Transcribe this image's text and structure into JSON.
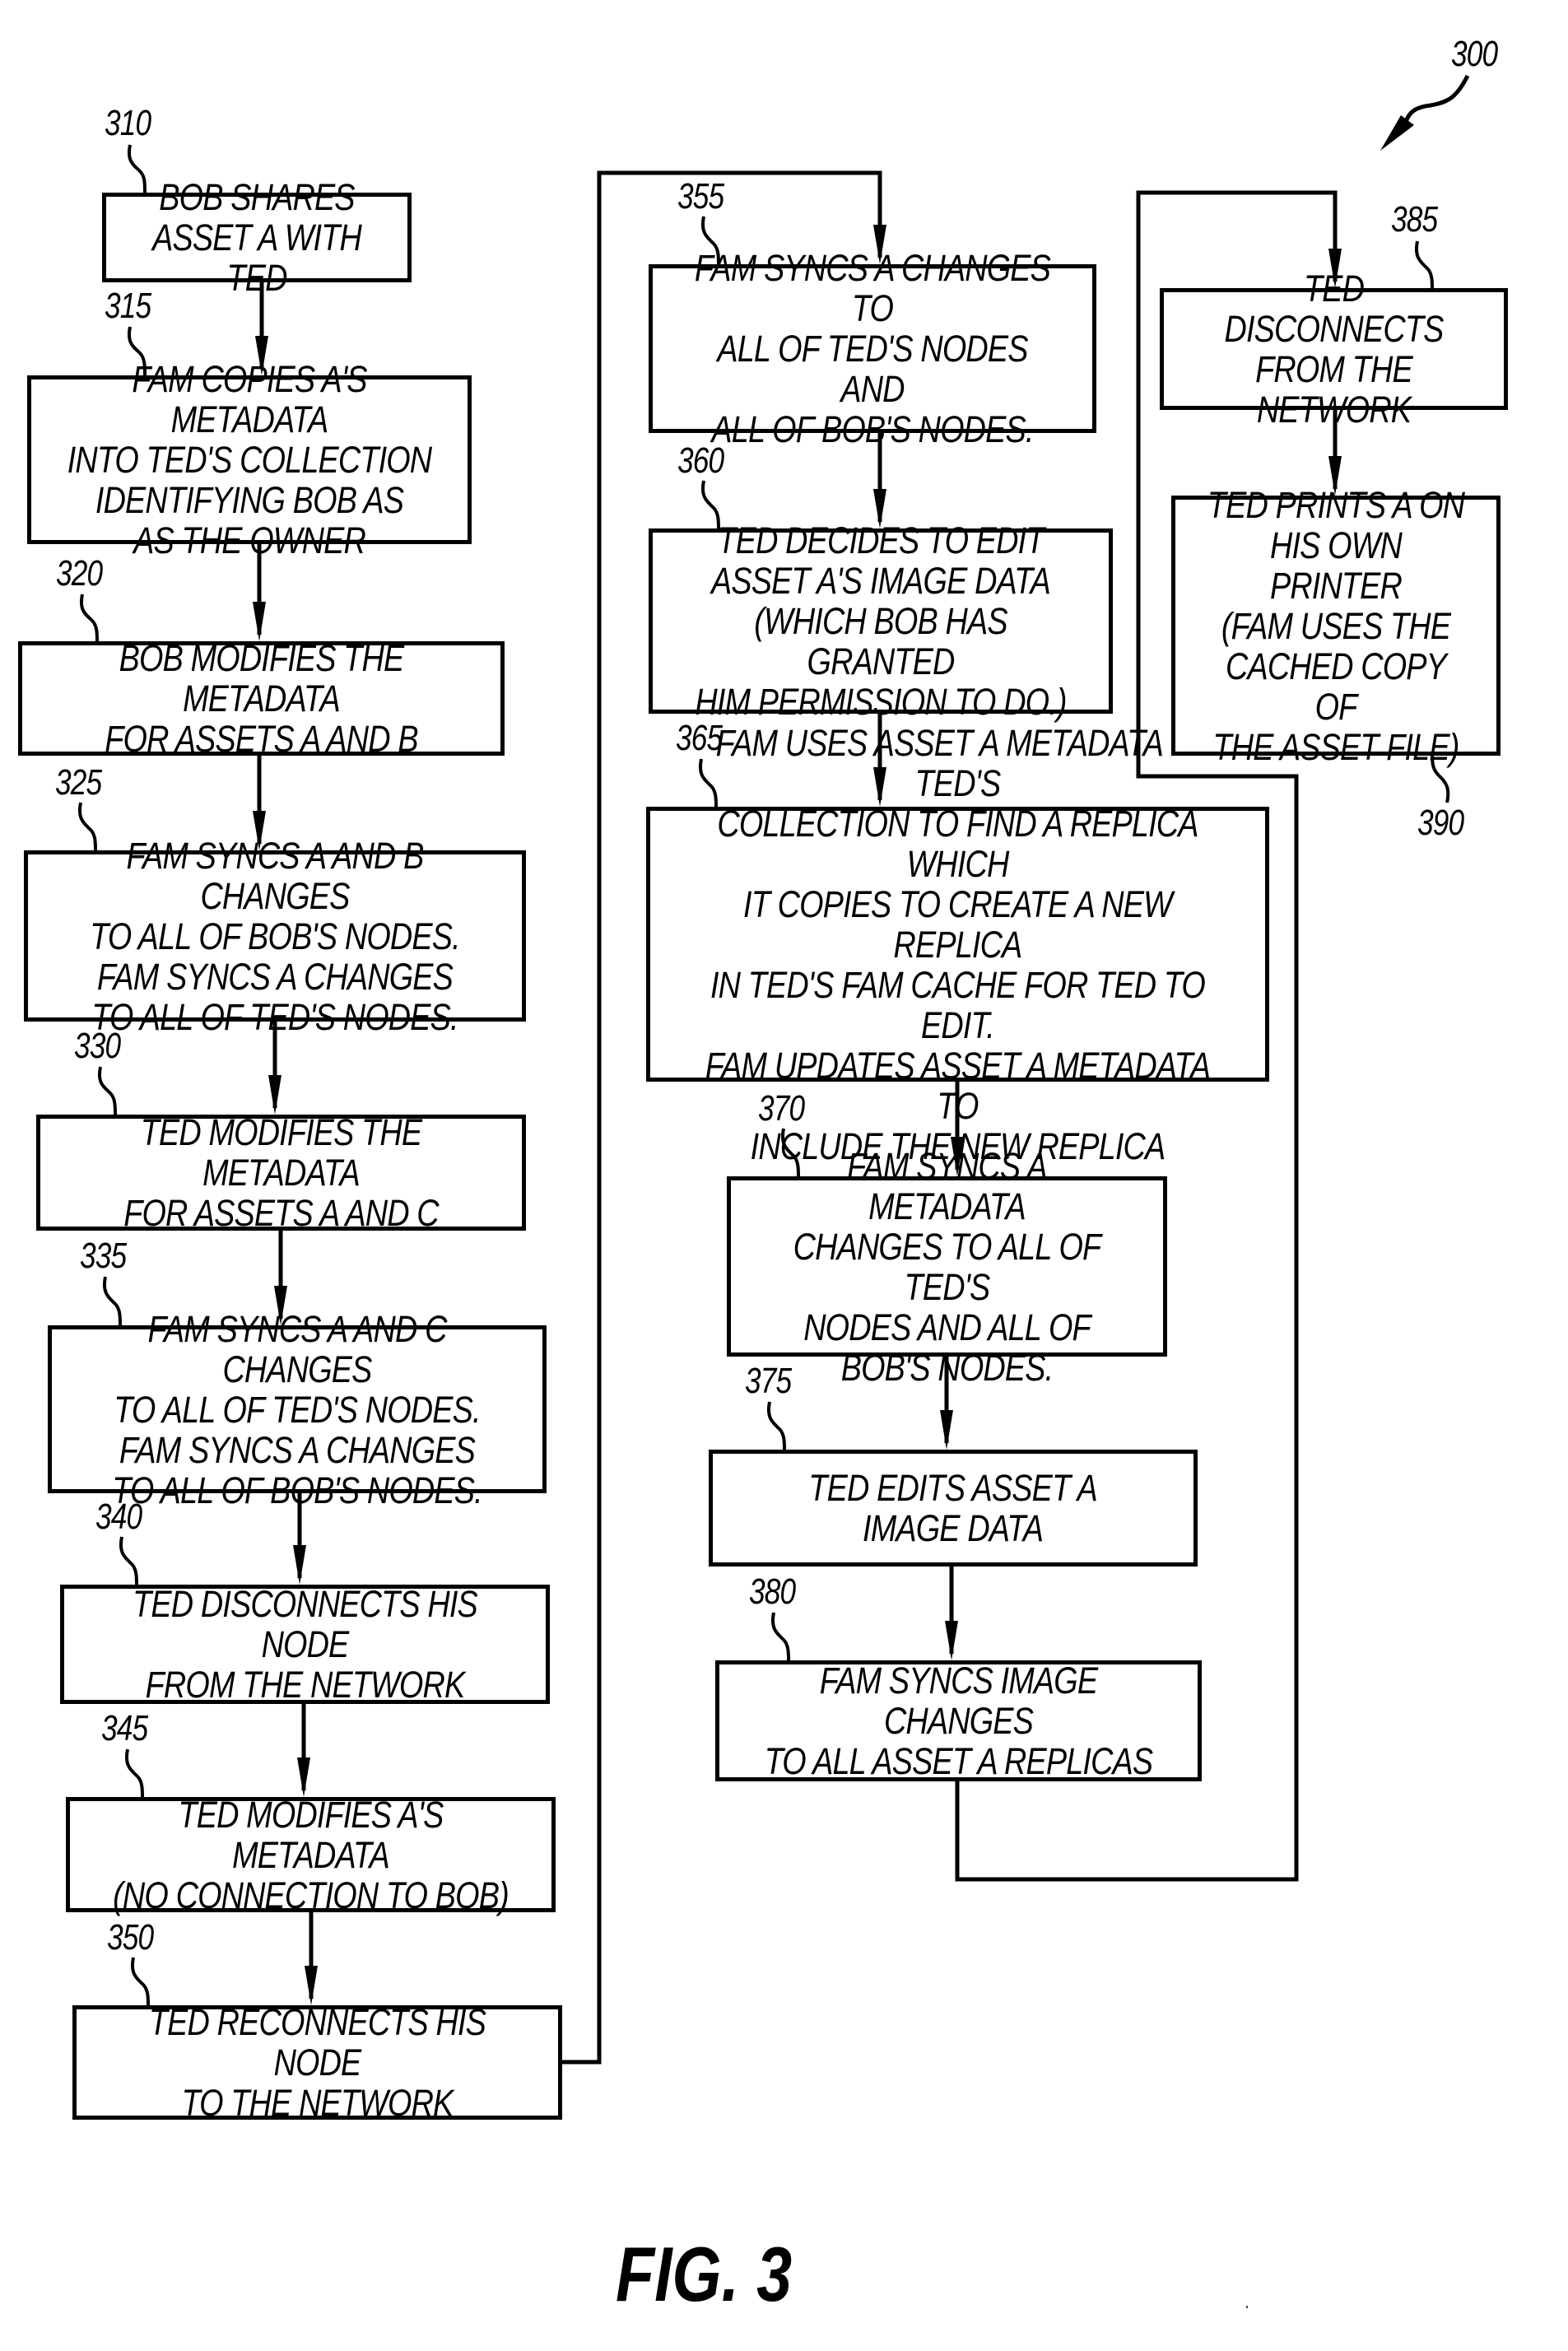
{
  "figure": {
    "number_label": "300",
    "caption": "FIG. 3"
  },
  "steps": [
    {
      "ref": "310",
      "text": "BOB SHARES\nASSET A WITH TED"
    },
    {
      "ref": "315",
      "text": "FAM COPIES A'S METADATA\nINTO TED'S COLLECTION\nIDENTIFYING BOB AS\nAS THE OWNER"
    },
    {
      "ref": "320",
      "text": "BOB MODIFIES THE METADATA\nFOR ASSETS A AND B"
    },
    {
      "ref": "325",
      "text": "FAM SYNCS A AND B CHANGES\nTO ALL OF BOB'S NODES.\nFAM SYNCS A CHANGES\nTO ALL OF TED'S NODES."
    },
    {
      "ref": "330",
      "text": "TED MODIFIES THE METADATA\nFOR ASSETS A AND C"
    },
    {
      "ref": "335",
      "text": "FAM SYNCS A AND C CHANGES\nTO ALL OF TED'S NODES.\nFAM SYNCS A CHANGES\nTO ALL OF BOB'S NODES."
    },
    {
      "ref": "340",
      "text": "TED DISCONNECTS HIS NODE\nFROM THE NETWORK"
    },
    {
      "ref": "345",
      "text": "TED MODIFIES A'S METADATA\n(NO CONNECTION TO BOB)"
    },
    {
      "ref": "350",
      "text": "TED RECONNECTS HIS NODE\nTO THE NETWORK"
    },
    {
      "ref": "355",
      "text": "FAM SYNCS A CHANGES TO\nALL OF TED'S NODES AND\nALL OF BOB'S NODES."
    },
    {
      "ref": "360",
      "text": "TED DECIDES TO EDIT\nASSET A'S IMAGE DATA\n(WHICH BOB HAS GRANTED\nHIM PERMISSION TO DO.)"
    },
    {
      "ref": "365",
      "text": "FAM USES ASSET A METADATA IN TED'S\nCOLLECTION TO FIND A REPLICA WHICH\nIT COPIES TO CREATE A NEW REPLICA\nIN TED'S FAM CACHE FOR TED TO EDIT.\nFAM UPDATES ASSET A METADATA TO\nINCLUDE THE NEW REPLICA"
    },
    {
      "ref": "370",
      "text": "FAM SYNCS A METADATA\nCHANGES TO ALL OF TED'S\nNODES AND ALL OF\nBOB'S NODES."
    },
    {
      "ref": "375",
      "text": "TED EDITS ASSET A\nIMAGE DATA"
    },
    {
      "ref": "380",
      "text": "FAM SYNCS IMAGE CHANGES\nTO ALL ASSET A REPLICAS"
    },
    {
      "ref": "385",
      "text": "TED DISCONNECTS\nFROM THE NETWORK"
    },
    {
      "ref": "390",
      "text": "TED PRINTS A ON\nHIS OWN PRINTER\n(FAM USES THE\nCACHED COPY OF\nTHE ASSET FILE)"
    }
  ],
  "flow": [
    [
      "310",
      "315"
    ],
    [
      "315",
      "320"
    ],
    [
      "320",
      "325"
    ],
    [
      "325",
      "330"
    ],
    [
      "330",
      "335"
    ],
    [
      "335",
      "340"
    ],
    [
      "340",
      "345"
    ],
    [
      "345",
      "350"
    ],
    [
      "350",
      "355"
    ],
    [
      "355",
      "360"
    ],
    [
      "360",
      "365"
    ],
    [
      "365",
      "370"
    ],
    [
      "370",
      "375"
    ],
    [
      "375",
      "380"
    ],
    [
      "380",
      "385"
    ],
    [
      "385",
      "390"
    ]
  ]
}
